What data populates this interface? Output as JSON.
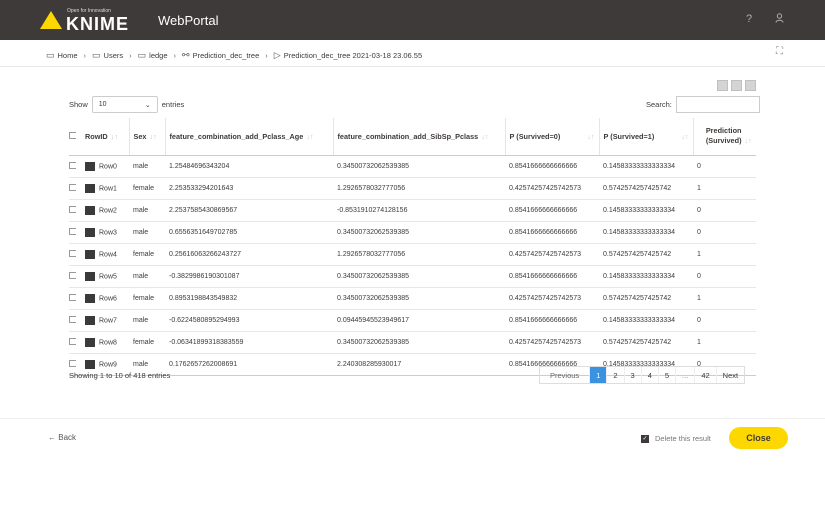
{
  "header": {
    "logo_tagline": "Open for Innovation",
    "logo_text": "KNIME",
    "app_title": "WebPortal",
    "help_icon": "?",
    "user_icon": "user-icon"
  },
  "breadcrumb": [
    "Home",
    "Users",
    "ledge",
    "Prediction_dec_tree",
    "Prediction_dec_tree 2021-03-18 23.06.55"
  ],
  "table_controls": {
    "show_label": "Show",
    "entries_value": "10",
    "entries_label": "entries",
    "search_label": "Search:",
    "search_value": ""
  },
  "table": {
    "columns": [
      "RowID",
      "Sex",
      "feature_combination_add_Pclass_Age",
      "feature_combination_add_SibSp_Pclass",
      "P (Survived=0)",
      "P (Survived=1)",
      "Prediction (Survived)"
    ],
    "rows": [
      [
        "Row0",
        "male",
        "1.25484696343204",
        "0.34500732062539385",
        "0.8541666666666666",
        "0.14583333333333334",
        "0"
      ],
      [
        "Row1",
        "female",
        "2.253533294201643",
        "1.2926578032777056",
        "0.42574257425742573",
        "0.5742574257425742",
        "1"
      ],
      [
        "Row2",
        "male",
        "2.2537585430869567",
        "-0.8531910274128156",
        "0.8541666666666666",
        "0.14583333333333334",
        "0"
      ],
      [
        "Row3",
        "male",
        "0.6556351649702785",
        "0.34500732062539385",
        "0.8541666666666666",
        "0.14583333333333334",
        "0"
      ],
      [
        "Row4",
        "female",
        "0.25616063266243727",
        "1.2926578032777056",
        "0.42574257425742573",
        "0.5742574257425742",
        "1"
      ],
      [
        "Row5",
        "male",
        "-0.3829986190301087",
        "0.34500732062539385",
        "0.8541666666666666",
        "0.14583333333333334",
        "0"
      ],
      [
        "Row6",
        "female",
        "0.8953198843549832",
        "0.34500732062539385",
        "0.42574257425742573",
        "0.5742574257425742",
        "1"
      ],
      [
        "Row7",
        "male",
        "-0.6224580895294993",
        "0.09445945523949617",
        "0.8541666666666666",
        "0.14583333333333334",
        "0"
      ],
      [
        "Row8",
        "female",
        "-0.06341899318383559",
        "0.34500732062539385",
        "0.42574257425742573",
        "0.5742574257425742",
        "1"
      ],
      [
        "Row9",
        "male",
        "0.1762657262008691",
        "2.240308285930017",
        "0.8541666666666666",
        "0.14583333333333334",
        "0"
      ]
    ]
  },
  "pagination": {
    "info": "Showing 1 to 10 of 418 entries",
    "previous": "Previous",
    "pages": [
      "1",
      "2",
      "3",
      "4",
      "5",
      "...",
      "42"
    ],
    "next": "Next",
    "current_page": "1"
  },
  "footer": {
    "back_label": "Back",
    "delete_label": "Delete this result",
    "close_label": "Close"
  },
  "colors": {
    "topbar": "#3e3a39",
    "accent_yellow": "#fdd800",
    "active_page": "#3a92e0"
  }
}
